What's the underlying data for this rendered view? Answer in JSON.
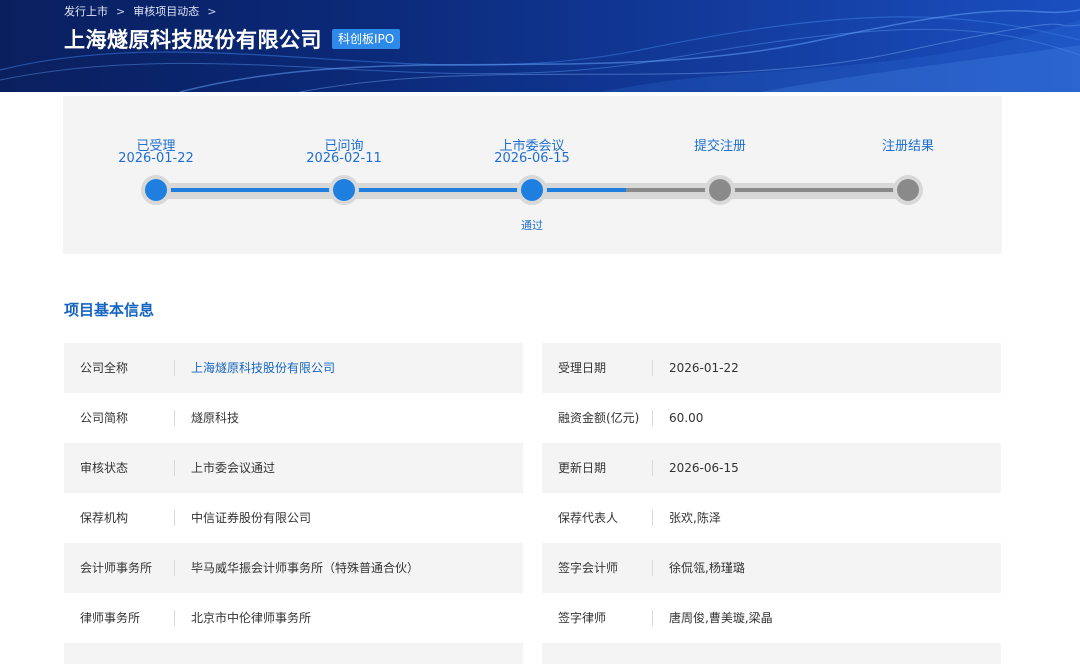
{
  "breadcrumb": [
    "发行上市",
    "审核项目动态"
  ],
  "breadcrumb_separator": ">",
  "company_title": "上海燧原科技股份有限公司",
  "board_badge": "科创板IPO",
  "timeline": [
    {
      "label": "已受理",
      "date": "2026-01-22",
      "status": "done",
      "result": ""
    },
    {
      "label": "已问询",
      "date": "2026-02-11",
      "status": "done",
      "result": ""
    },
    {
      "label": "上市委会议",
      "date": "2026-06-15",
      "status": "done",
      "result": "通过"
    },
    {
      "label": "提交注册",
      "date": "",
      "status": "pending",
      "result": ""
    },
    {
      "label": "注册结果",
      "date": "",
      "status": "pending",
      "result": ""
    }
  ],
  "colors": {
    "active": "#1f7fe0",
    "pending_node": "#8a8a8a",
    "pending_bar": "#8a8a8a",
    "accent_text": "#1565c0",
    "badge": "#2d8ae8"
  },
  "section_title": "项目基本信息",
  "info_rows": [
    {
      "left": {
        "key": "公司全称",
        "value": "上海燧原科技股份有限公司",
        "link": true
      },
      "right": {
        "key": "受理日期",
        "value": "2026-01-22"
      }
    },
    {
      "left": {
        "key": "公司简称",
        "value": "燧原科技"
      },
      "right": {
        "key": "融资金额(亿元)",
        "value": "60.00"
      }
    },
    {
      "left": {
        "key": "审核状态",
        "value": "上市委会议通过"
      },
      "right": {
        "key": "更新日期",
        "value": "2026-06-15"
      }
    },
    {
      "left": {
        "key": "保荐机构",
        "value": "中信证券股份有限公司"
      },
      "right": {
        "key": "保荐代表人",
        "value": "张欢,陈泽"
      }
    },
    {
      "left": {
        "key": "会计师事务所",
        "value": "毕马威华振会计师事务所（特殊普通合伙）"
      },
      "right": {
        "key": "签字会计师",
        "value": "徐侃瓴,杨瑾璐"
      }
    },
    {
      "left": {
        "key": "律师事务所",
        "value": "北京市中伦律师事务所"
      },
      "right": {
        "key": "签字律师",
        "value": "唐周俊,曹美璇,梁晶"
      }
    },
    {
      "left": {
        "key": "",
        "value": ""
      },
      "right": {
        "key": "",
        "value": ""
      }
    }
  ]
}
